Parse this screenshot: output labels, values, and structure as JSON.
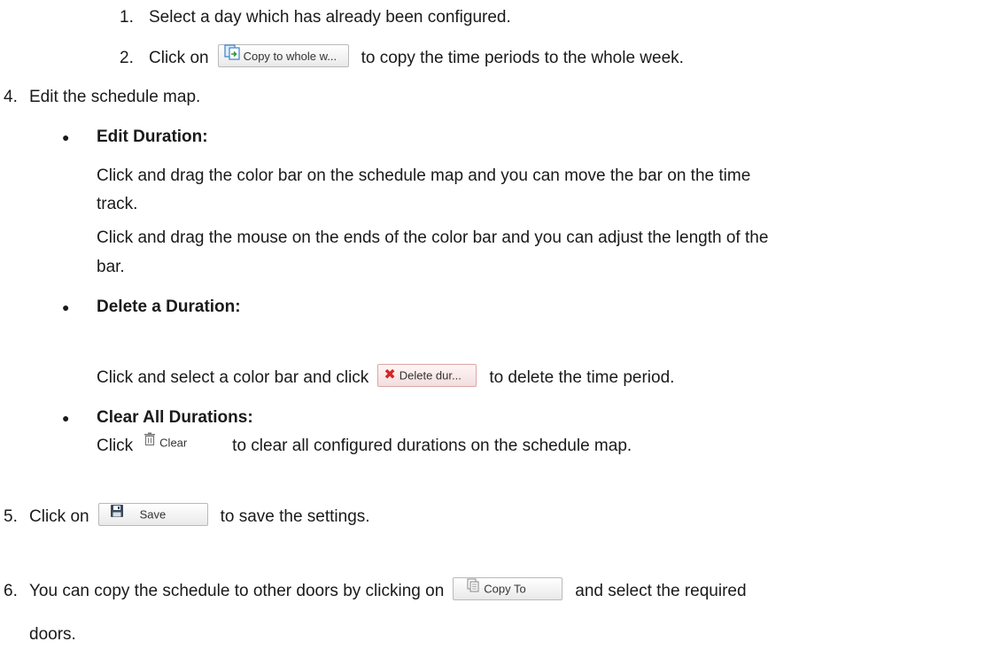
{
  "items": {
    "sub1": {
      "num": "1.",
      "text": "Select a day which has already been configured."
    },
    "sub2": {
      "num": "2.",
      "before": "Click on",
      "after": "to copy the time periods to the whole week."
    },
    "step4": {
      "num": "4.",
      "text": "Edit the schedule map."
    },
    "edit_duration": {
      "title": "Edit Duration:",
      "line1": "Click and drag the color bar on the schedule map and you can move the bar on the time",
      "line2": "track.",
      "line3": "Click and drag the mouse on the ends of the color bar and you can adjust the length of the",
      "line4": "bar."
    },
    "delete_duration": {
      "title": "Delete a Duration:",
      "before": "Click and select a color bar and click",
      "after": "to delete the time period."
    },
    "clear_all": {
      "title": "Clear All Durations:",
      "before": "Click",
      "after": "to clear all configured durations on the schedule map."
    },
    "step5": {
      "num": "5.",
      "before": "Click on",
      "after": "to save the settings."
    },
    "step6": {
      "num": "6.",
      "before": "You can copy the schedule to other doors by clicking on",
      "after": "and select the required",
      "line2": "doors."
    }
  },
  "buttons": {
    "copy_week": "Copy to whole w...",
    "delete_dur": "Delete dur...",
    "clear": "Clear",
    "save": "Save",
    "copy_to": "Copy To"
  },
  "bullet_glyph": "●",
  "icons": {
    "copy_week": "copy-week-icon",
    "delete": "delete-x-icon",
    "clear": "trash-icon",
    "save": "floppy-disk-icon",
    "copy_to": "copy-document-icon"
  },
  "colors": {
    "text": "#1a1a1a",
    "delete_x": "#d62424",
    "button_border": "#b9b9b9"
  }
}
